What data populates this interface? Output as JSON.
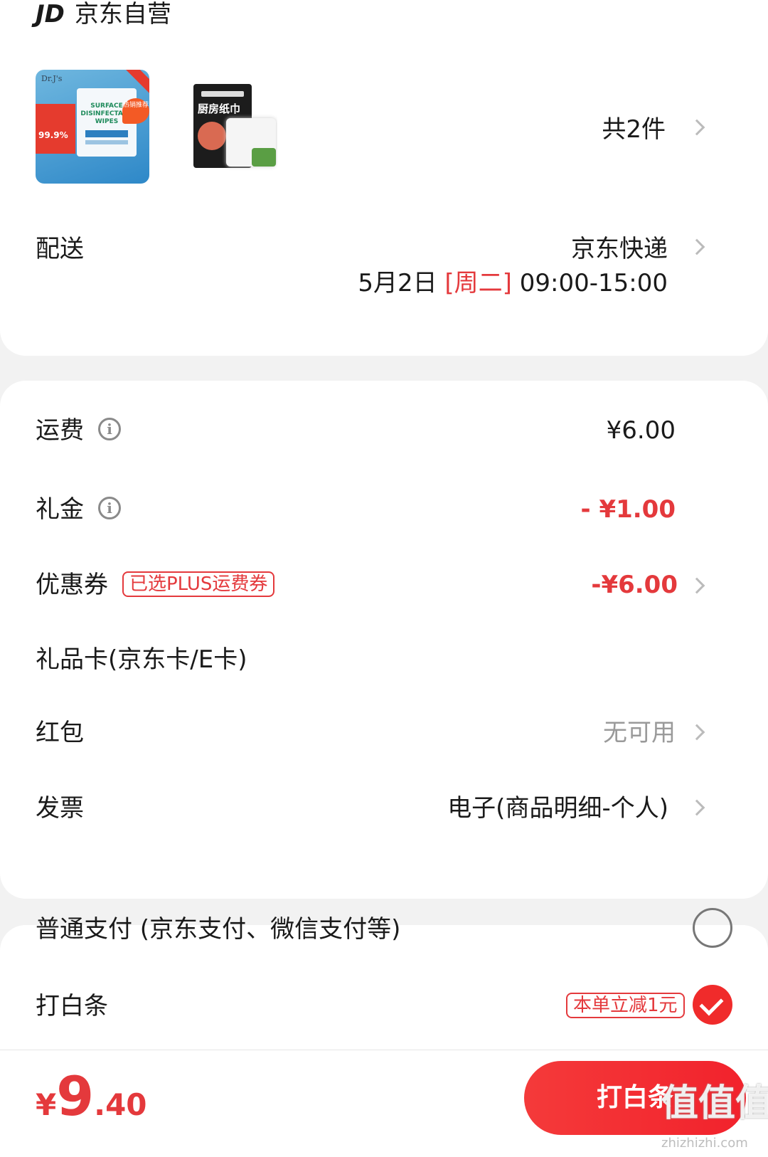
{
  "store": {
    "logo": "JD",
    "name": "京东自营"
  },
  "items": {
    "count_label": "共2件",
    "thumbs": [
      {
        "brand": "Dr.J's",
        "title": "SURFACE DISINFECTANT WIPES",
        "badge": "热销推荐",
        "claim": "99.9%"
      },
      {
        "brand": "",
        "title": "厨房纸巾",
        "badge": "",
        "claim": ""
      }
    ]
  },
  "delivery": {
    "label": "配送",
    "carrier": "京东快递",
    "date": "5月2日",
    "weekday": "[周二]",
    "window": "09:00-15:00"
  },
  "fees": {
    "shipping": {
      "label": "运费",
      "value": "¥6.00"
    },
    "gift_money": {
      "label": "礼金",
      "value": "- ¥1.00"
    },
    "coupon": {
      "label": "优惠券",
      "tag": "已选PLUS运费券",
      "value": "-¥6.00"
    },
    "gift_card": {
      "label": "礼品卡(京东卡/E卡)"
    },
    "red_packet": {
      "label": "红包",
      "value": "无可用"
    },
    "invoice": {
      "label": "发票",
      "value": "电子(商品明细-个人)"
    }
  },
  "payment": {
    "normal": {
      "label": "普通支付 (京东支付、微信支付等)",
      "selected": false
    },
    "baitiao": {
      "label": "打白条",
      "tag": "本单立减1元",
      "selected": true
    }
  },
  "footer": {
    "currency": "¥",
    "price_int": "9",
    "price_dec": ".40",
    "button": "打白条"
  },
  "watermark": {
    "text": "值值值",
    "url": "zhizhizhi.com"
  },
  "colors": {
    "accent": "#e4393c",
    "button": "#f2222c",
    "background": "#f2f2f2"
  }
}
